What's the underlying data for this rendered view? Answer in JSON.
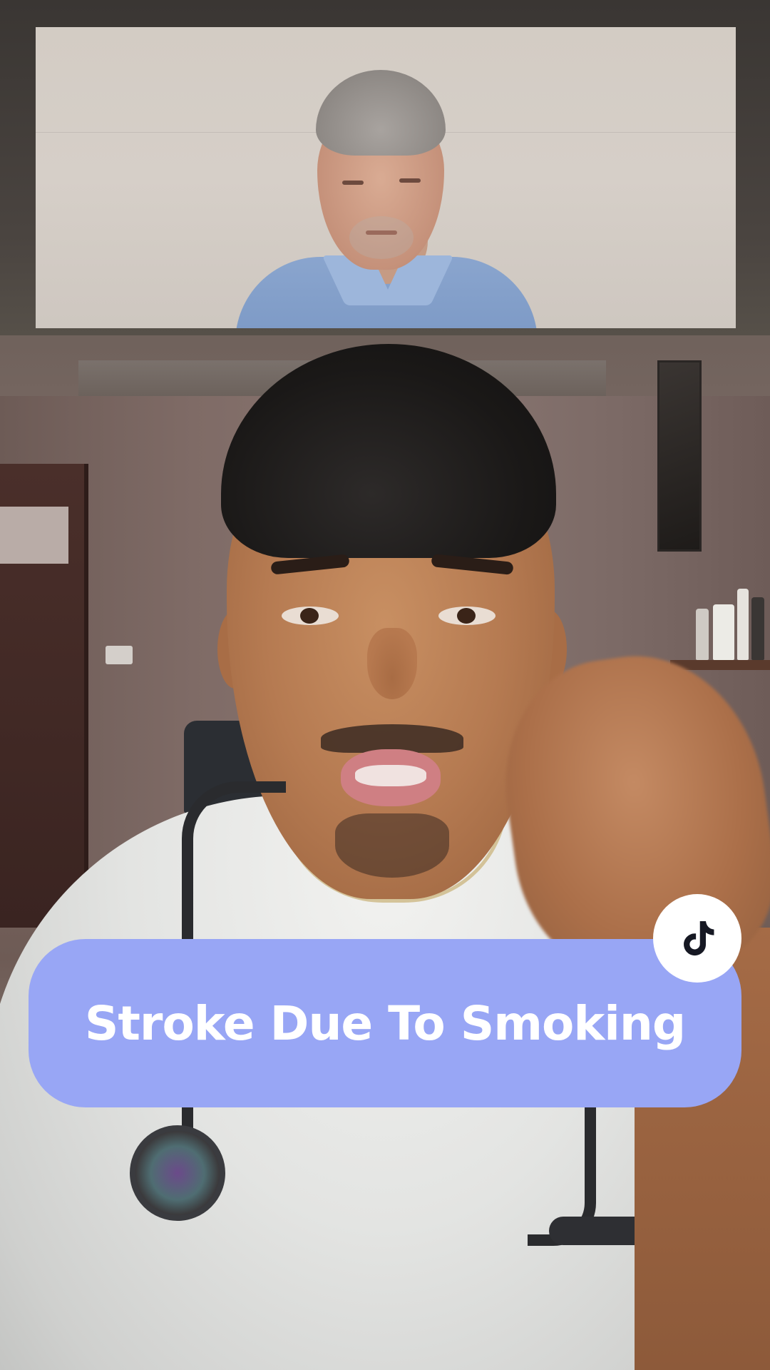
{
  "caption": {
    "text": "Stroke Due To Smoking",
    "background_color": "#98a6f5",
    "text_color": "#ffffff"
  },
  "badge": {
    "icon": "tiktok-logo-icon",
    "background_color": "#ffffff"
  },
  "inset_clip": {
    "subject": "older-man-portrait"
  },
  "background_video": {
    "subject": "doctor-with-stethoscope"
  }
}
